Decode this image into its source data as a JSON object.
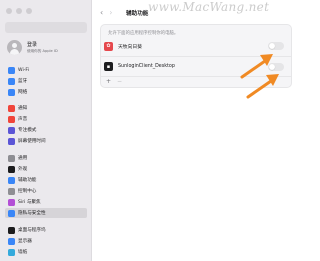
{
  "watermark": "www.MacWang.net",
  "sidebar": {
    "account": {
      "name": "登录",
      "subtitle": "使用你的 Apple ID"
    },
    "items": [
      {
        "label": "Wi-Fi",
        "icon": "wifi-icon",
        "glyph": "",
        "color": "#3a86f7"
      },
      {
        "label": "蓝牙",
        "icon": "bluetooth-icon",
        "glyph": "",
        "color": "#3a86f7"
      },
      {
        "label": "网络",
        "icon": "globe-icon",
        "glyph": "",
        "color": "#3a86f7"
      },
      {
        "label": "通知",
        "icon": "bell-icon",
        "glyph": "",
        "color": "#f0453b"
      },
      {
        "label": "声音",
        "icon": "speaker-icon",
        "glyph": "",
        "color": "#f0453b"
      },
      {
        "label": "专注模式",
        "icon": "moon-icon",
        "glyph": "",
        "color": "#5b55d6"
      },
      {
        "label": "屏幕使用时间",
        "icon": "hourglass-icon",
        "glyph": "",
        "color": "#5b55d6"
      },
      {
        "label": "通用",
        "icon": "gear-icon",
        "glyph": "",
        "color": "#8e8e93"
      },
      {
        "label": "外观",
        "icon": "appearance-icon",
        "glyph": "",
        "color": "#1c1c1e"
      },
      {
        "label": "辅助功能",
        "icon": "accessibility-icon",
        "glyph": "",
        "color": "#3a86f7"
      },
      {
        "label": "控制中心",
        "icon": "control-center-icon",
        "glyph": "",
        "color": "#8e8e93"
      },
      {
        "label": "Siri 与聚焦",
        "icon": "siri-icon",
        "glyph": "",
        "color": "#b34fd6"
      },
      {
        "label": "隐私与安全性",
        "icon": "hand-icon",
        "glyph": "",
        "color": "#3a86f7",
        "selected": true
      },
      {
        "label": "桌面与程序坞",
        "icon": "dock-icon",
        "glyph": "",
        "color": "#1c1c1e"
      },
      {
        "label": "显示器",
        "icon": "display-icon",
        "glyph": "",
        "color": "#3a86f7"
      },
      {
        "label": "墙纸",
        "icon": "wallpaper-icon",
        "glyph": "",
        "color": "#34aadc"
      }
    ]
  },
  "main": {
    "back_glyph": "‹",
    "forward_glyph": "›",
    "title": "辅助功能",
    "description": "允许下面的应用程序控制你的电脑。",
    "apps": [
      {
        "name": "天牧向日葵",
        "icon": "sunflower-app-icon",
        "color": "#e5484d",
        "enabled": false
      },
      {
        "name": "SunloginClient_Desktop",
        "icon": "terminal-app-icon",
        "color": "#1c1c1e",
        "enabled": false
      }
    ],
    "add_label": "+",
    "remove_label": "−"
  }
}
